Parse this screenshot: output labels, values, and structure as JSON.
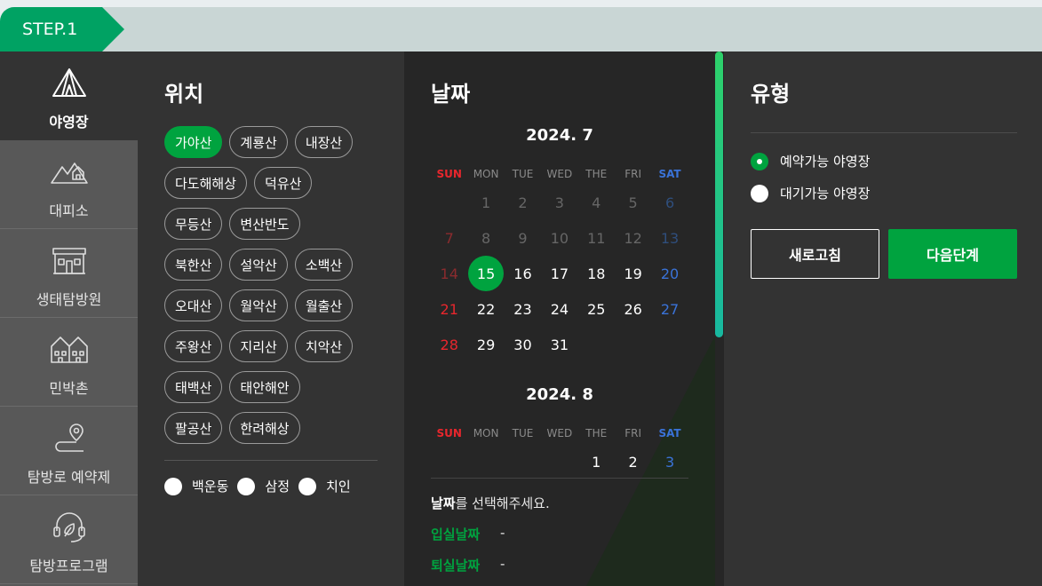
{
  "step": {
    "label": "STEP.1"
  },
  "sidebar": {
    "items": [
      {
        "label": "야영장",
        "icon": "tent-icon",
        "active": true
      },
      {
        "label": "대피소",
        "icon": "shelter-icon"
      },
      {
        "label": "생태탐방원",
        "icon": "eco-center-icon"
      },
      {
        "label": "민박촌",
        "icon": "village-icon"
      },
      {
        "label": "탐방로 예약제",
        "icon": "trail-pin-icon"
      },
      {
        "label": "탐방프로그램",
        "icon": "headset-leaf-icon"
      }
    ]
  },
  "location": {
    "title": "위치",
    "parks": [
      [
        "가야산",
        "계룡산",
        "내장산"
      ],
      [
        "다도해해상",
        "덕유산"
      ],
      [
        "무등산",
        "변산반도"
      ],
      [
        "북한산",
        "설악산",
        "소백산"
      ],
      [
        "오대산",
        "월악산",
        "월출산"
      ],
      [
        "주왕산",
        "지리산",
        "치악산"
      ],
      [
        "태백산",
        "태안해안"
      ],
      [
        "팔공산",
        "한려해상"
      ]
    ],
    "selected": "가야산",
    "sub_areas": [
      "백운동",
      "삼정",
      "치인"
    ]
  },
  "date": {
    "title": "날짜",
    "weekdays": [
      "SUN",
      "MON",
      "TUE",
      "WED",
      "THE",
      "FRI",
      "SAT"
    ],
    "months": [
      {
        "label": "2024. 7",
        "weeks": [
          [
            "",
            "1",
            "2",
            "3",
            "4",
            "5",
            "6"
          ],
          [
            "7",
            "8",
            "9",
            "10",
            "11",
            "12",
            "13"
          ],
          [
            "14",
            "15",
            "16",
            "17",
            "18",
            "19",
            "20"
          ],
          [
            "21",
            "22",
            "23",
            "24",
            "25",
            "26",
            "27"
          ],
          [
            "28",
            "29",
            "30",
            "31",
            "",
            "",
            ""
          ]
        ],
        "selectable_from": "15",
        "selected": "15"
      },
      {
        "label": "2024. 8",
        "weeks": [
          [
            "",
            "",
            "",
            "",
            "1",
            "2",
            "3"
          ]
        ]
      }
    ],
    "prompt_bold": "날짜",
    "prompt_rest": "를 선택해주세요.",
    "checkin_label": "입실날짜",
    "checkin_value": "-",
    "checkout_label": "퇴실날짜",
    "checkout_value": "-"
  },
  "type": {
    "title": "유형",
    "options": [
      {
        "label": "예약가능 야영장",
        "checked": true
      },
      {
        "label": "대기가능 야영장",
        "checked": false
      }
    ],
    "refresh_label": "새로고침",
    "next_label": "다음단계"
  },
  "colors": {
    "accent_green": "#00a33f",
    "step_green": "#00a263",
    "sunday_red": "#e8262d",
    "saturday_blue": "#3a73d8"
  }
}
